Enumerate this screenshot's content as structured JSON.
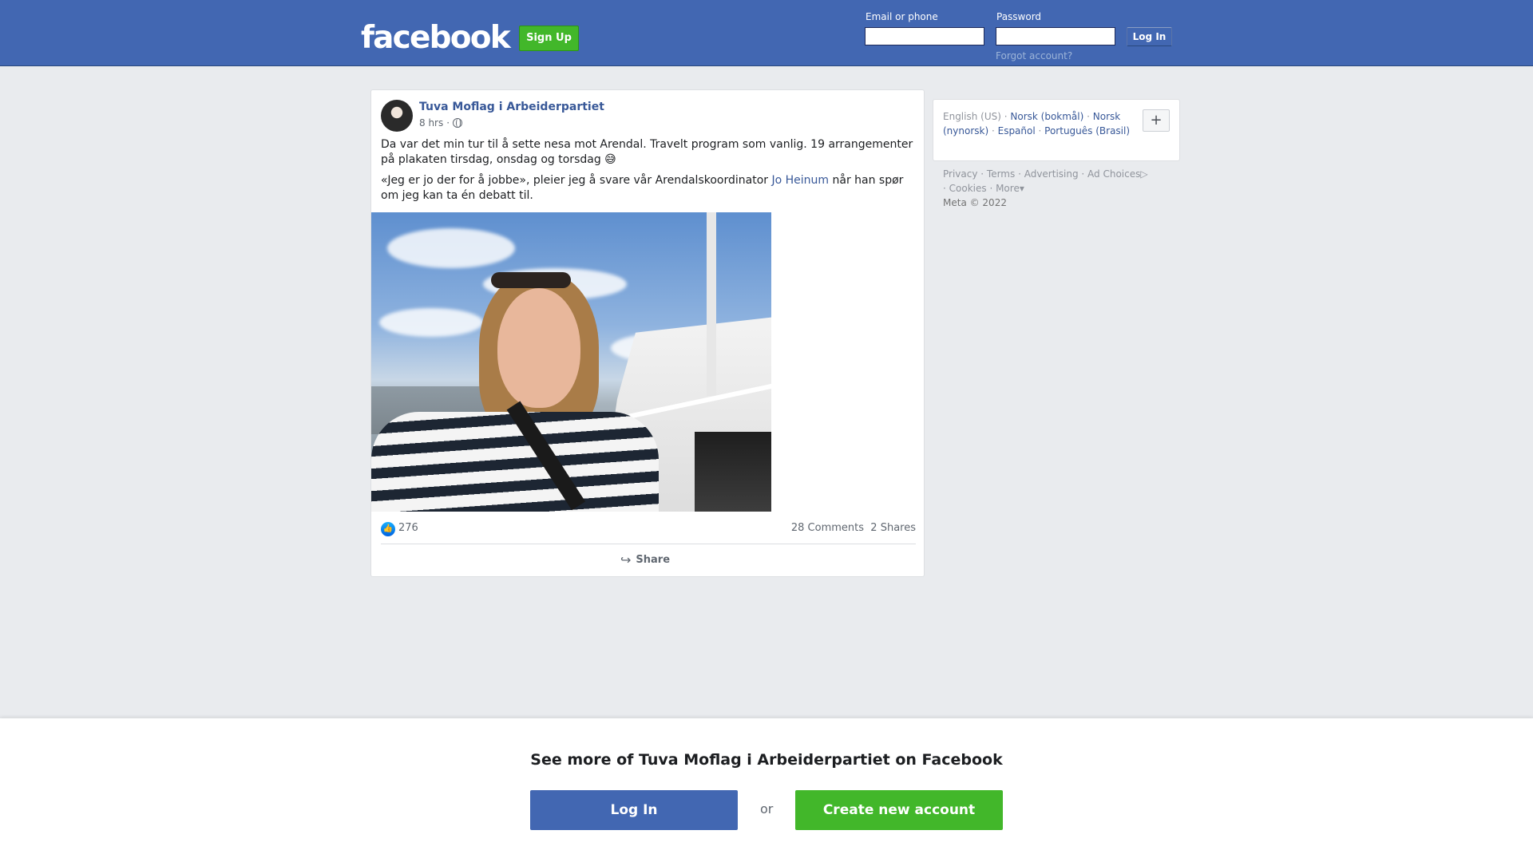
{
  "header": {
    "logo": "facebook",
    "signup_label": "Sign Up",
    "email_label": "Email or phone",
    "password_label": "Password",
    "login_label": "Log In",
    "forgot_label": "Forgot account?"
  },
  "post": {
    "author": "Tuva Moflag i Arbeiderpartiet",
    "time": "8 hrs",
    "privacy_icon": "globe-icon",
    "paragraph1": "Da var det min tur til å sette nesa mot Arendal. Travelt program som vanlig. 19 arrangementer på plakaten tirsdag, onsdag og torsdag 😅",
    "paragraph2_before": "«Jeg er jo der for å jobbe», pleier jeg å svare vår Arendalskoordinator ",
    "paragraph2_mention": "Jo Heinum",
    "paragraph2_after": " når han spør om jeg kan ta én debatt til.",
    "photo_icon": "photo",
    "likes": "276",
    "comments": "28 Comments",
    "shares": "2 Shares",
    "share_label": "Share"
  },
  "sidebar": {
    "languages": [
      "English (US)",
      "Norsk (bokmål)",
      "Norsk (nynorsk)",
      "Español",
      "Português (Brasil)"
    ],
    "add_language": "+",
    "footer": [
      "Privacy",
      "Terms",
      "Advertising",
      "Ad Choices",
      "Cookies",
      "More"
    ],
    "copyright": "Meta © 2022"
  },
  "banner": {
    "title": "See more of Tuva Moflag i Arbeiderpartiet on Facebook",
    "login_label": "Log In",
    "or_label": "or",
    "create_label": "Create new account"
  },
  "colors": {
    "brand_blue": "#4267b2",
    "green": "#42b72a",
    "link": "#385898"
  }
}
